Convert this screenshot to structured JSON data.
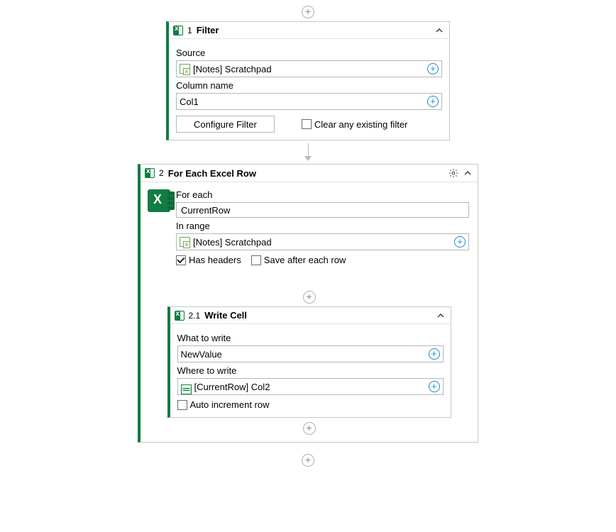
{
  "filter": {
    "index": "1",
    "title": "Filter",
    "source_label": "Source",
    "source_value": "[Notes] Scratchpad",
    "column_label": "Column name",
    "column_value": "Col1",
    "configure_btn": "Configure Filter",
    "clear_checkbox_label": "Clear any existing filter",
    "clear_checked": false
  },
  "foreach": {
    "index": "2",
    "title": "For Each Excel Row",
    "for_each_label": "For each",
    "for_each_value": "CurrentRow",
    "in_range_label": "In range",
    "in_range_value": "[Notes] Scratchpad",
    "has_headers_label": "Has headers",
    "has_headers_checked": true,
    "save_after_label": "Save after each row",
    "save_after_checked": false
  },
  "writecell": {
    "index": "2.1",
    "title": "Write Cell",
    "what_label": "What to write",
    "what_value": "NewValue",
    "where_label": "Where to write",
    "where_value": "[CurrentRow] Col2",
    "auto_inc_label": "Auto increment row",
    "auto_inc_checked": false
  }
}
